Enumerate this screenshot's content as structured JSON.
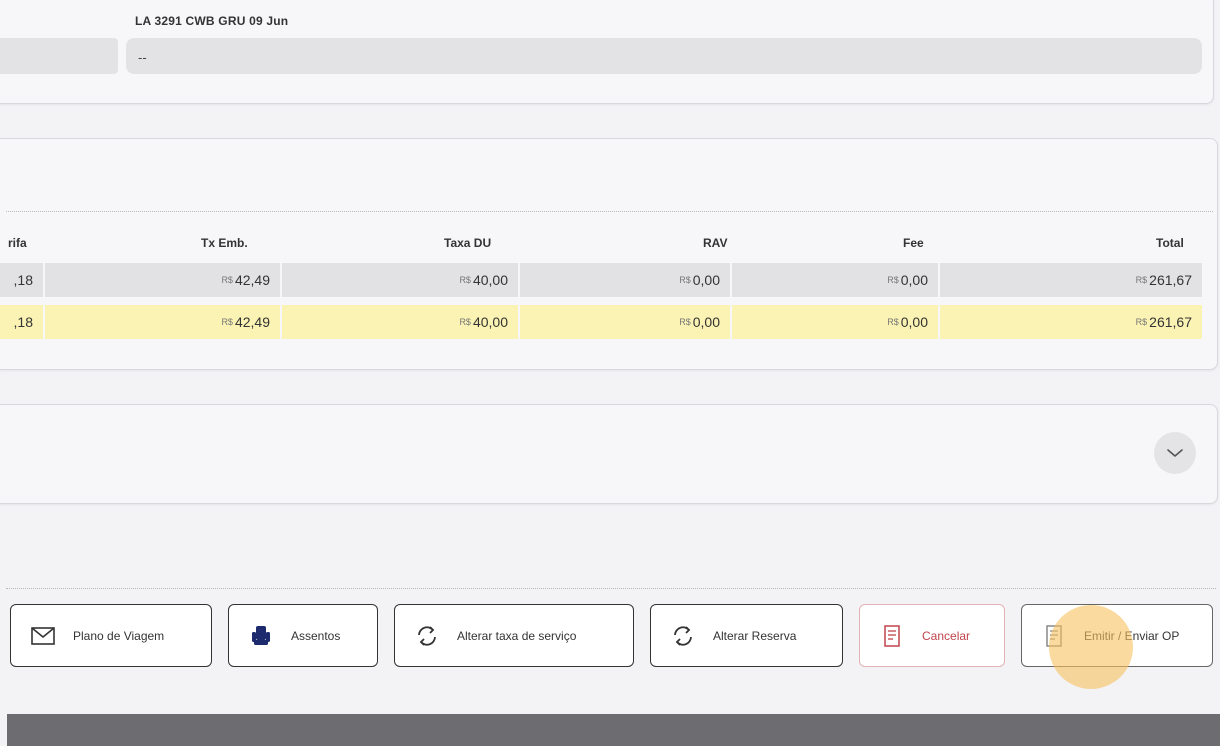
{
  "flight": {
    "title": "LA 3291 CWB GRU 09 Jun",
    "value": "--"
  },
  "fare_table": {
    "headers": {
      "tarifa": "rifa",
      "tx_emb": "Tx Emb.",
      "taxa_du": "Taxa DU",
      "rav": "RAV",
      "fee": "Fee",
      "total": "Total"
    },
    "currency": "R$",
    "rows": [
      {
        "tarifa": ",18",
        "tx_emb": "42,49",
        "taxa_du": "40,00",
        "rav": "0,00",
        "fee": "0,00",
        "total": "261,67"
      },
      {
        "tarifa": ",18",
        "tx_emb": "42,49",
        "taxa_du": "40,00",
        "rav": "0,00",
        "fee": "0,00",
        "total": "261,67"
      }
    ]
  },
  "actions": {
    "plano": "Plano de Viagem",
    "assentos": "Assentos",
    "alterar_taxa": "Alterar taxa de serviço",
    "alterar_reserva": "Alterar Reserva",
    "cancelar": "Cancelar",
    "emitir": "Emitir / Enviar OP"
  },
  "colors": {
    "highlight_row": "#fbf3b3",
    "cancel": "#c0444c",
    "cursor_highlight": "#f6c15e"
  },
  "icons": {
    "expand": "chevron-down-icon",
    "plano": "envelope-icon",
    "assentos": "seat-icon",
    "alterar": "refresh-icon",
    "cancelar": "document-cancel-icon",
    "emitir": "document-icon"
  }
}
